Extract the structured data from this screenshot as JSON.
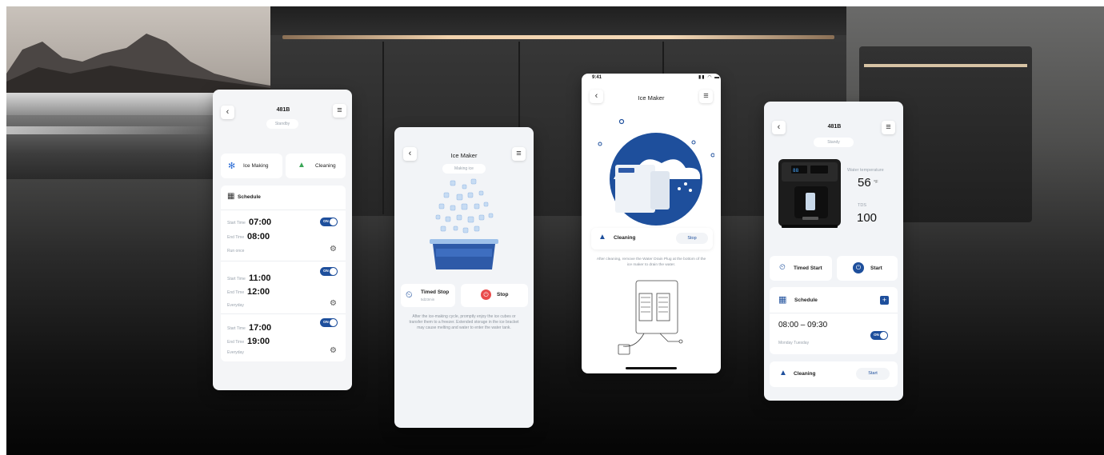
{
  "colors": {
    "accent_blue": "#1e4f9c",
    "stop_red": "#e94b4b",
    "card_bg": "#f2f4f7",
    "ice_green": "#3aa657"
  },
  "card1": {
    "title": "481B",
    "status": "Standby",
    "mode_ice": "Ice Making",
    "mode_clean": "Cleaning",
    "schedule_label": "Schedule",
    "start_label": "Start Time",
    "end_label": "End Time",
    "toggle_label": "ON",
    "entries": [
      {
        "start": "07:00",
        "end": "08:00",
        "repeat": "Run once"
      },
      {
        "start": "11:00",
        "end": "12:00",
        "repeat": "Everyday"
      },
      {
        "start": "17:00",
        "end": "19:00",
        "repeat": "Everyday"
      }
    ]
  },
  "card2": {
    "title": "Ice Maker",
    "status": "Making ice",
    "timed_stop_label": "Timed Stop",
    "timed_stop_sub": "5d23min",
    "stop_label": "Stop",
    "notice": "After the ice-making cycle, promptly enjoy the ice cubes or transfer them to a freezer. Extended storage in the ice bracket may cause melting and water to enter the water tank."
  },
  "card3": {
    "status_time": "9:41",
    "title": "Ice Maker",
    "cleaning_label": "Cleaning",
    "stop_label": "Stop",
    "notice": "After cleaning, remove the Water Drain Plug at the bottom of the ice maker to drain the water."
  },
  "card4": {
    "title": "481B",
    "status": "Standy",
    "water_temp_label": "Water temperature",
    "water_temp_value": "56",
    "water_temp_unit": "°F",
    "tds_label": "TDS",
    "tds_value": "100",
    "timed_start_label": "Timed Start",
    "start_label": "Start",
    "schedule_label": "Schedule",
    "schedule_time": "08:00 – 09:30",
    "schedule_days": "Monday Tuesday",
    "toggle_label": "ON",
    "cleaning_label": "Cleaning",
    "cleaning_start": "Start"
  }
}
